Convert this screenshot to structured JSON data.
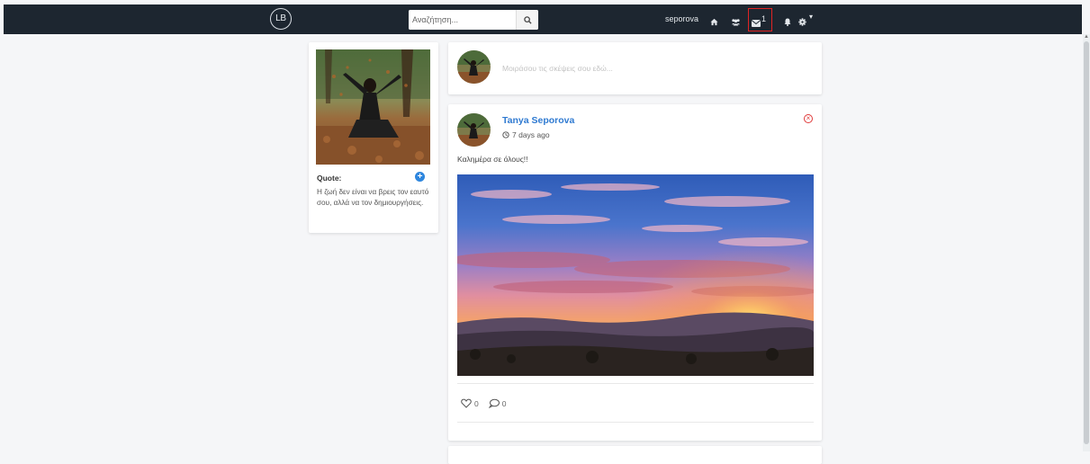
{
  "navbar": {
    "logo_text": "LB",
    "search_placeholder": "Αναζήτηση...",
    "username": "seporova",
    "messages_count": "1",
    "icons": [
      "home-icon",
      "friends-icon",
      "mail-icon",
      "bell-icon",
      "gear-icon",
      "caret-down-icon"
    ]
  },
  "profile": {
    "quote_label": "Quote:",
    "quote_text": "Η ζωή δεν είναι να βρεις τον εαυτό σου, αλλά να τον δημιουργήσεις."
  },
  "composer": {
    "placeholder": "Μοιράσου τις σκέψεις σου εδώ..."
  },
  "post": {
    "author": "Tanya Seporova",
    "time_ago": "7 days ago",
    "text": "Καλημέρα σε όλους!!",
    "likes": "0",
    "comments": "0"
  },
  "colors": {
    "navbar_bg": "#1d2630",
    "accent_link": "#2f7ad1",
    "delete_red": "#e03a3a",
    "highlight_border": "#e02424"
  }
}
